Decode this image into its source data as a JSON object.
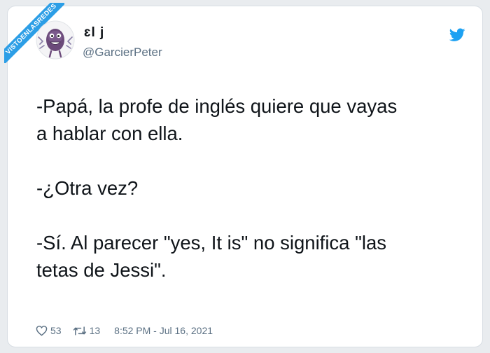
{
  "watermark": "VISTOENLASREDES",
  "author": {
    "name": "ɛl   j",
    "handle": "@GarcierPeter"
  },
  "tweet": {
    "lines": [
      "-Papá, la profe de inglés quiere que vayas",
      "a hablar con ella.",
      "-¿Otra vez?",
      "-Sí. Al parecer \"yes, It is\" no significa \"las",
      "tetas de Jessi\"."
    ]
  },
  "footer": {
    "likes": "53",
    "retweets": "13",
    "timestamp": "8:52 PM - Jul 16, 2021"
  },
  "icons": {
    "brand": "twitter-bird-icon",
    "like": "heart-icon",
    "retweet": "retweet-icon"
  },
  "colors": {
    "twitter_blue": "#1da1f2",
    "ribbon_blue": "#2c9ee6",
    "text_primary": "#0f1419",
    "text_secondary": "#5b7083"
  }
}
